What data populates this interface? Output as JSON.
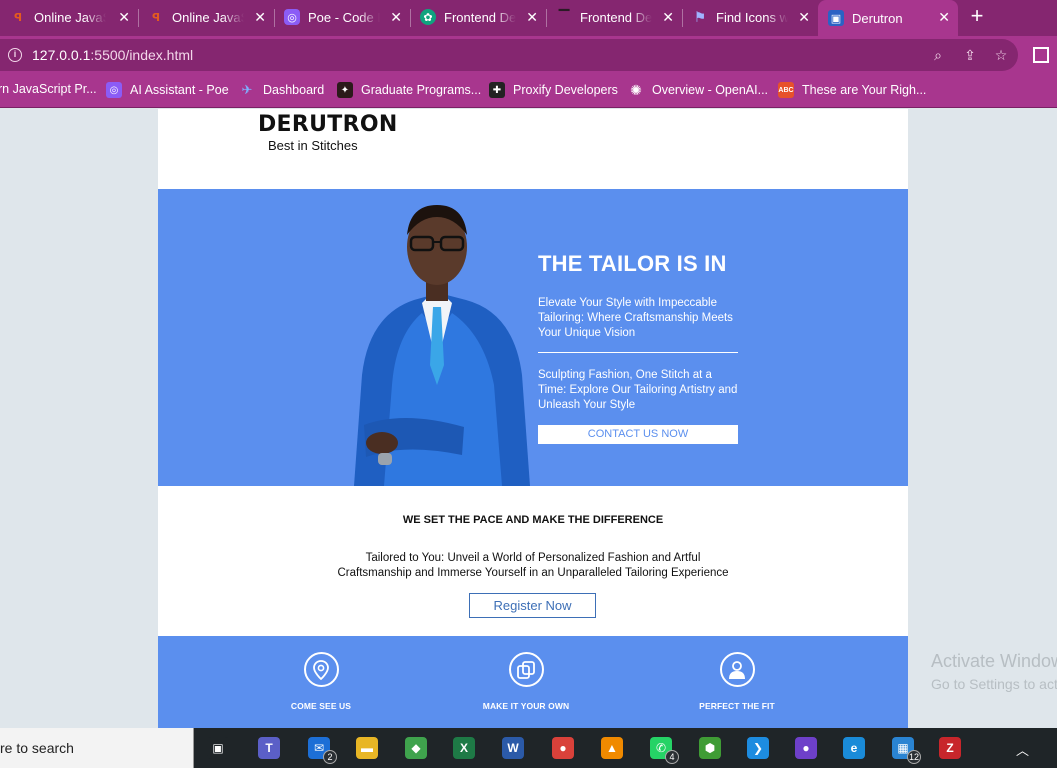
{
  "browser": {
    "tabs": [
      {
        "title": "Online JavaScript",
        "icon": "replit-icon",
        "color": "#e45a1f"
      },
      {
        "title": "Online JavaScript",
        "icon": "replit-icon",
        "color": "#e45a1f"
      },
      {
        "title": "Poe - Code Ed",
        "icon": "poe-icon",
        "color": "#8b5cf6"
      },
      {
        "title": "Frontend Dev",
        "icon": "chatgpt-icon",
        "color": "#10a37f"
      },
      {
        "title": "Frontend Dev",
        "icon": "frontend-icon",
        "color": "#5d1656"
      },
      {
        "title": "Find Icons with",
        "icon": "flag-icon",
        "color": "#4f6be8"
      },
      {
        "title": "Derutron",
        "icon": "vscode-live-icon",
        "color": "#2b62c4",
        "active": true
      }
    ],
    "address": {
      "host": "127.0.0.1",
      "rest": ":5500/index.html"
    },
    "bookmarks": [
      {
        "label": "rn JavaScript Pr...",
        "icon": "replit-icon",
        "color": "#e45a1f"
      },
      {
        "label": "AI Assistant - Poe",
        "icon": "poe-icon",
        "color": "#8b5cf6"
      },
      {
        "label": "Dashboard",
        "icon": "dashboard-icon",
        "color": "#2e7cf6"
      },
      {
        "label": "Graduate Programs...",
        "icon": "graduate-icon",
        "color": "#c9412c"
      },
      {
        "label": "Proxify Developers",
        "icon": "proxify-icon",
        "color": "#222"
      },
      {
        "label": "Overview - OpenAI...",
        "icon": "openai-icon",
        "color": "#222"
      },
      {
        "label": "These are Your Righ...",
        "icon": "rights-icon",
        "color": "#e7512b"
      }
    ]
  },
  "site": {
    "brand": "DERUTRON",
    "tagline": "Best in Stitches",
    "hero": {
      "title": "THE TAILOR IS IN",
      "p1": "Elevate Your Style with Impeccable Tailoring: Where Craftsmanship Meets Your Unique Vision",
      "p2": "Sculpting Fashion, One Stitch at a Time: Explore Our Tailoring Artistry and Unleash Your Style",
      "contact_label": "CONTACT US NOW"
    },
    "pace_title": "WE SET THE PACE AND MAKE THE DIFFERENCE",
    "pace_desc": "Tailored to You: Unveil a World of Personalized Fashion and Artful Craftsmanship and Immerse Yourself in an Unparalleled Tailoring Experience",
    "register_label": "Register Now",
    "features": [
      {
        "label": "COME SEE US",
        "icon": "location-pin-icon"
      },
      {
        "label": "MAKE IT YOUR OWN",
        "icon": "copy-icon"
      },
      {
        "label": "PERFECT THE FIT",
        "icon": "user-icon"
      }
    ],
    "accent": "#5b8fee"
  },
  "watermark": {
    "line1": "Activate Windows",
    "line2": "Go to Settings to activate Windows."
  },
  "taskbar": {
    "search_text": "re to search",
    "items": [
      {
        "icon": "task-view-icon",
        "color": "#1f2528",
        "glyph": "▣"
      },
      {
        "icon": "teams-icon",
        "color": "#5b5fc7",
        "glyph": "T"
      },
      {
        "icon": "mail-icon",
        "color": "#1d6fd6",
        "glyph": "✉",
        "badge": "2"
      },
      {
        "icon": "file-explorer-icon",
        "color": "#e8b625",
        "glyph": "▬"
      },
      {
        "icon": "git-icon",
        "color": "#3fa34d",
        "glyph": "◆"
      },
      {
        "icon": "excel-icon",
        "color": "#1e7a46",
        "glyph": "X"
      },
      {
        "icon": "word-icon",
        "color": "#2b5aa8",
        "glyph": "W"
      },
      {
        "icon": "chrome-icon",
        "color": "#d9413a",
        "glyph": "●",
        "active": true
      },
      {
        "icon": "vlc-icon",
        "color": "#f08a00",
        "glyph": "▲"
      },
      {
        "icon": "whatsapp-icon",
        "color": "#25d366",
        "glyph": "✆",
        "badge": "4"
      },
      {
        "icon": "nodejs-icon",
        "color": "#3f9c35",
        "glyph": "⬢"
      },
      {
        "icon": "vscode-icon",
        "color": "#1d8ce0",
        "glyph": "❯"
      },
      {
        "icon": "github-icon",
        "color": "#6e40c9",
        "glyph": "●"
      },
      {
        "icon": "edge-icon",
        "color": "#1a8bd8",
        "glyph": "e"
      },
      {
        "icon": "teams-desktop-icon",
        "color": "#2a84d2",
        "glyph": "▦",
        "badge": "12"
      },
      {
        "icon": "filezilla-icon",
        "color": "#c8262b",
        "glyph": "Z"
      }
    ]
  }
}
